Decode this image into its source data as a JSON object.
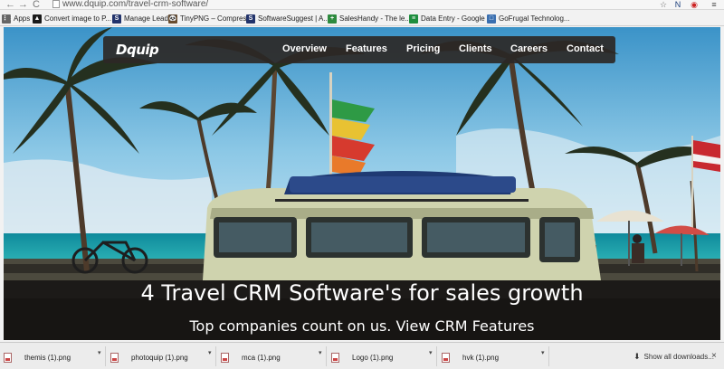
{
  "browser": {
    "url": "www.dquip.com/travel-crm-software/",
    "nav": {
      "back": "←",
      "forward": "→",
      "reload": "C"
    },
    "extensions": [
      {
        "label": "☆",
        "color": "#666666"
      },
      {
        "label": "N",
        "color": "#1a3d7a"
      },
      {
        "label": "◉",
        "color": "#cc2222"
      },
      {
        "label": "≡",
        "color": "#444444"
      }
    ]
  },
  "bookmarks": [
    {
      "label": "Apps",
      "icon": "apps-icon",
      "color": "#666666",
      "glyph": "⋮⋮"
    },
    {
      "label": "Convert image to P...",
      "icon": "convert-icon",
      "color": "#1a1a1a",
      "glyph": "▲"
    },
    {
      "label": "Manage Lead",
      "icon": "manage-icon",
      "color": "#22336b",
      "glyph": "S"
    },
    {
      "label": "TinyPNG – Compres...",
      "icon": "tinypng-icon",
      "color": "#6b4d2e",
      "glyph": "🐼"
    },
    {
      "label": "SoftwareSuggest | A...",
      "icon": "softwaresuggest-icon",
      "color": "#22336b",
      "glyph": "S"
    },
    {
      "label": "SalesHandy - The le...",
      "icon": "saleshandy-icon",
      "color": "#2d8a3e",
      "glyph": "+"
    },
    {
      "label": "Data Entry - Google ...",
      "icon": "sheets-icon",
      "color": "#1e8e3e",
      "glyph": "≡"
    },
    {
      "label": "GoFrugal Technolog...",
      "icon": "gofrugal-icon",
      "color": "#3a6fb0",
      "glyph": "□"
    }
  ],
  "site": {
    "logo": "Dquip",
    "nav": [
      "Overview",
      "Features",
      "Pricing",
      "Clients",
      "Careers",
      "Contact"
    ],
    "hero_title": "4 Travel CRM Software's for sales growth",
    "hero_subtitle": "Top companies count on us. View CRM Features"
  },
  "downloads": {
    "items": [
      "themis (1).png",
      "photoquip (1).png",
      "mca (1).png",
      "Logo (1).png",
      "hvk (1).png"
    ],
    "show_all": "Show all downloads...",
    "close": "×"
  }
}
